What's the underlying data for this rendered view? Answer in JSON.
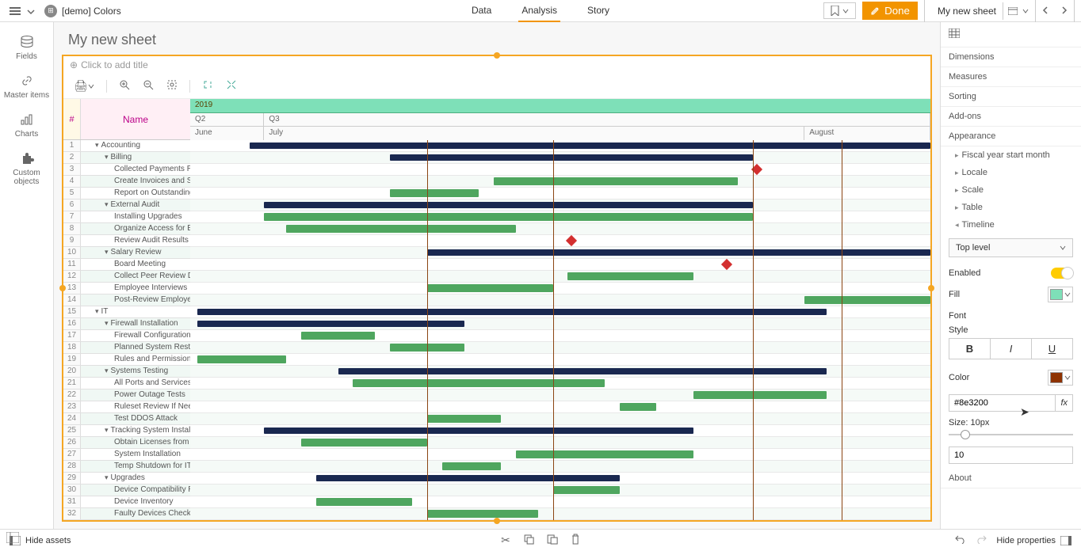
{
  "header": {
    "app_name": "[demo] Colors",
    "tabs": [
      "Data",
      "Analysis",
      "Story"
    ],
    "active_tab": 1,
    "done_label": "Done",
    "sheet_name": "My new sheet"
  },
  "left_tools": [
    {
      "icon": "db",
      "label": "Fields"
    },
    {
      "icon": "link",
      "label": "Master items"
    },
    {
      "icon": "chart",
      "label": "Charts"
    },
    {
      "icon": "puzzle",
      "label": "Custom objects"
    }
  ],
  "sheet": {
    "title": "My new sheet",
    "chart_title_placeholder": "Click to add title"
  },
  "gantt": {
    "header_num": "#",
    "header_name": "Name",
    "timeline": {
      "year": "2019",
      "quarters": [
        {
          "label": "Q2",
          "width": 10
        },
        {
          "label": "Q3",
          "width": 90
        }
      ],
      "months": [
        {
          "label": "June",
          "width": 10
        },
        {
          "label": "July",
          "width": 73
        },
        {
          "label": "August",
          "width": 17
        }
      ]
    },
    "rows": [
      {
        "n": 1,
        "name": "Accounting",
        "lvl": 0,
        "exp": "▾",
        "type": "summary",
        "start": 8,
        "end": 100
      },
      {
        "n": 2,
        "name": "Billing",
        "lvl": 1,
        "exp": "▾",
        "type": "summary",
        "start": 27,
        "end": 76
      },
      {
        "n": 3,
        "name": "Collected Payments Revie",
        "lvl": 2,
        "milestone": 76
      },
      {
        "n": 4,
        "name": "Create Invoices and Send t",
        "lvl": 2,
        "type": "task",
        "start": 41,
        "end": 74
      },
      {
        "n": 5,
        "name": "Report on Outstanding Col",
        "lvl": 2,
        "type": "task",
        "start": 27,
        "end": 39
      },
      {
        "n": 6,
        "name": "External Audit",
        "lvl": 1,
        "exp": "▾",
        "type": "summary",
        "start": 10,
        "end": 76
      },
      {
        "n": 7,
        "name": "Installing Upgrades",
        "lvl": 2,
        "type": "task",
        "start": 10,
        "end": 76
      },
      {
        "n": 8,
        "name": "Organize Access for Extern",
        "lvl": 2,
        "type": "task",
        "start": 13,
        "end": 44
      },
      {
        "n": 9,
        "name": "Review Audit Results",
        "lvl": 2,
        "milestone": 51
      },
      {
        "n": 10,
        "name": "Salary Review",
        "lvl": 1,
        "exp": "▾",
        "type": "summary",
        "start": 32,
        "end": 100
      },
      {
        "n": 11,
        "name": "Board Meeting",
        "lvl": 2,
        "milestone": 72
      },
      {
        "n": 12,
        "name": "Collect Peer Review Data",
        "lvl": 2,
        "type": "task",
        "start": 51,
        "end": 68
      },
      {
        "n": 13,
        "name": "Employee Interviews",
        "lvl": 2,
        "type": "task",
        "start": 32,
        "end": 49
      },
      {
        "n": 14,
        "name": "Post-Review Employee Int",
        "lvl": 2,
        "type": "task",
        "start": 83,
        "end": 100
      },
      {
        "n": 15,
        "name": "IT",
        "lvl": 0,
        "exp": "▾",
        "type": "summary",
        "start": 1,
        "end": 86
      },
      {
        "n": 16,
        "name": "Firewall Installation",
        "lvl": 1,
        "exp": "▾",
        "type": "summary",
        "start": 1,
        "end": 37
      },
      {
        "n": 17,
        "name": "Firewall Configuration",
        "lvl": 2,
        "type": "task",
        "start": 15,
        "end": 25
      },
      {
        "n": 18,
        "name": "Planned System Restart",
        "lvl": 2,
        "type": "task",
        "start": 27,
        "end": 37
      },
      {
        "n": 19,
        "name": "Rules and Permissions Aud",
        "lvl": 2,
        "type": "task",
        "start": 1,
        "end": 13
      },
      {
        "n": 20,
        "name": "Systems Testing",
        "lvl": 1,
        "exp": "▾",
        "type": "summary",
        "start": 20,
        "end": 86
      },
      {
        "n": 21,
        "name": "All Ports and Services Test",
        "lvl": 2,
        "type": "task",
        "start": 22,
        "end": 56
      },
      {
        "n": 22,
        "name": "Power Outage Tests",
        "lvl": 2,
        "type": "task",
        "start": 68,
        "end": 86
      },
      {
        "n": 23,
        "name": "Ruleset Review If Needed",
        "lvl": 2,
        "type": "task",
        "start": 58,
        "end": 63
      },
      {
        "n": 24,
        "name": "Test DDOS Attack",
        "lvl": 2,
        "type": "task",
        "start": 32,
        "end": 42
      },
      {
        "n": 25,
        "name": "Tracking System Installation",
        "lvl": 1,
        "exp": "▾",
        "type": "summary",
        "start": 10,
        "end": 68
      },
      {
        "n": 26,
        "name": "Obtain Licenses from the V",
        "lvl": 2,
        "type": "task",
        "start": 15,
        "end": 32
      },
      {
        "n": 27,
        "name": "System Installation",
        "lvl": 2,
        "type": "task",
        "start": 44,
        "end": 68
      },
      {
        "n": 28,
        "name": "Temp Shutdown for IT Aud",
        "lvl": 2,
        "type": "task",
        "start": 34,
        "end": 42
      },
      {
        "n": 29,
        "name": "Upgrades",
        "lvl": 1,
        "exp": "▾",
        "type": "summary",
        "start": 17,
        "end": 58
      },
      {
        "n": 30,
        "name": "Device Compatibility Revie",
        "lvl": 2,
        "type": "task",
        "start": 49,
        "end": 58
      },
      {
        "n": 31,
        "name": "Device Inventory",
        "lvl": 2,
        "type": "task",
        "start": 17,
        "end": 30
      },
      {
        "n": 32,
        "name": "Faulty Devices Check",
        "lvl": 2,
        "type": "task",
        "start": 32,
        "end": 47
      }
    ]
  },
  "right_panel": {
    "sections": [
      "Dimensions",
      "Measures",
      "Sorting",
      "Add-ons",
      "Appearance"
    ],
    "appearance_subs": [
      "Fiscal year start month",
      "Locale",
      "Scale",
      "Table",
      "Timeline"
    ],
    "timeline": {
      "dropdown": "Top level",
      "enabled_label": "Enabled",
      "fill_label": "Fill",
      "fill_color": "#7ee0b8",
      "font_label": "Font",
      "style_label": "Style",
      "style_buttons": [
        "B",
        "I",
        "U"
      ],
      "color_label": "Color",
      "color_value": "#8e3200",
      "color_hex": "#8e3200",
      "size_label": "Size: 10px",
      "size_value": "10"
    },
    "about": "About"
  },
  "footer": {
    "hide_assets": "Hide assets",
    "hide_properties": "Hide properties"
  }
}
